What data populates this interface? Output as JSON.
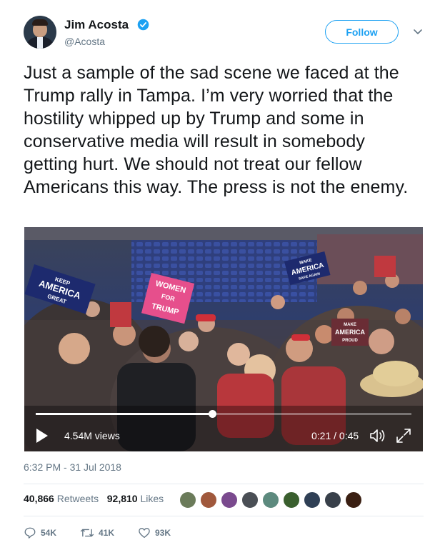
{
  "author": {
    "name": "Jim Acosta",
    "handle": "@Acosta",
    "verified": true
  },
  "follow_button": {
    "label": "Follow"
  },
  "tweet": {
    "text": "Just a sample of the sad scene we faced at the Trump rally in Tampa. I’m very worried that the hostility whipped up by Trump and some in conservative media will result in somebody getting hurt. We should not treat our fellow Americans this way. The press is not the enemy.",
    "timestamp": "6:32 PM - 31 Jul 2018"
  },
  "video": {
    "views": "4.54M views",
    "time": "0:21 / 0:45",
    "progress": 0.47,
    "sign_texts": [
      "KEEP",
      "AMERICA",
      "GREAT",
      "WOMEN",
      "FOR",
      "TRUMP",
      "MAKE",
      "AMERICA",
      "SAFE AGAIN",
      "MAKE",
      "AMERICA",
      "PROUD"
    ]
  },
  "stats": {
    "retweets_count": "40,866",
    "retweets_label": "Retweets",
    "likes_count": "92,810",
    "likes_label": "Likes"
  },
  "actions": {
    "reply_count": "54K",
    "retweet_count": "41K",
    "like_count": "93K"
  },
  "colors": {
    "accent": "#1da1f2",
    "text": "#14171a",
    "secondary": "#657786",
    "divider": "#e6ecf0"
  }
}
